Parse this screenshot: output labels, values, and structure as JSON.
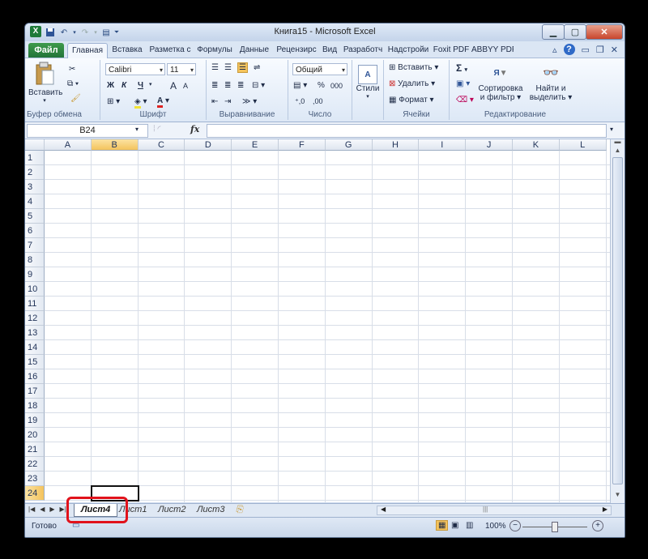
{
  "window": {
    "title": "Книга15 - Microsoft Excel",
    "app_icon": "excel-icon",
    "controls": [
      "minimize-icon",
      "maximize-icon",
      "close-icon"
    ]
  },
  "qat": {
    "save": "save-icon",
    "undo": "undo-icon",
    "redo": "redo-icon",
    "customize": "customize-qat-icon"
  },
  "menu": {
    "file": "Файл",
    "tabs": [
      "Главная",
      "Вставка",
      "Разметка с",
      "Формулы",
      "Данные",
      "Рецензирс",
      "Вид",
      "Разработч",
      "Надстройи",
      "Foxit PDF",
      "ABBYY PDF"
    ],
    "active": "Главная"
  },
  "ribbon": {
    "clipboard": {
      "paste": "Вставить",
      "label": "Буфер обмена"
    },
    "font": {
      "name": "Calibri",
      "size": "11",
      "bold": "Ж",
      "italic": "К",
      "underline": "Ч",
      "grow": "A",
      "shrink": "A",
      "label": "Шрифт"
    },
    "alignment": {
      "label": "Выравнивание"
    },
    "number": {
      "format": "Общий",
      "percent": "%",
      "thousands": "000",
      "label": "Число"
    },
    "styles": {
      "label": "Стили"
    },
    "cells": {
      "insert": "Вставить",
      "delete": "Удалить",
      "format": "Формат",
      "label": "Ячейки"
    },
    "editing": {
      "sum": "Σ",
      "sort_line1": "Сортировка",
      "sort_line2": "и фильтр",
      "find_line1": "Найти и",
      "find_line2": "выделить",
      "label": "Редактирование"
    }
  },
  "formula_bar": {
    "name_box": "B24",
    "fx": "fx",
    "value": ""
  },
  "grid": {
    "columns": [
      "A",
      "B",
      "C",
      "D",
      "E",
      "F",
      "G",
      "H",
      "I",
      "J",
      "K",
      "L"
    ],
    "rows": [
      "1",
      "2",
      "3",
      "4",
      "5",
      "6",
      "7",
      "8",
      "9",
      "10",
      "11",
      "12",
      "13",
      "14",
      "15",
      "16",
      "17",
      "18",
      "19",
      "20",
      "21",
      "22",
      "23",
      "24"
    ],
    "selected_cell": "B24",
    "selected_column": "B",
    "selected_row": "24"
  },
  "sheets": {
    "tabs": [
      "Лист4",
      "Лист1",
      "Лист2",
      "Лист3"
    ],
    "active": "Лист4"
  },
  "status": {
    "ready": "Готово",
    "zoom": "100%",
    "zoom_minus": "−",
    "zoom_plus": "+"
  },
  "colors": {
    "accent_file": "#2f8a43",
    "selection": "#f4c35c",
    "highlight": "#e1121b"
  }
}
